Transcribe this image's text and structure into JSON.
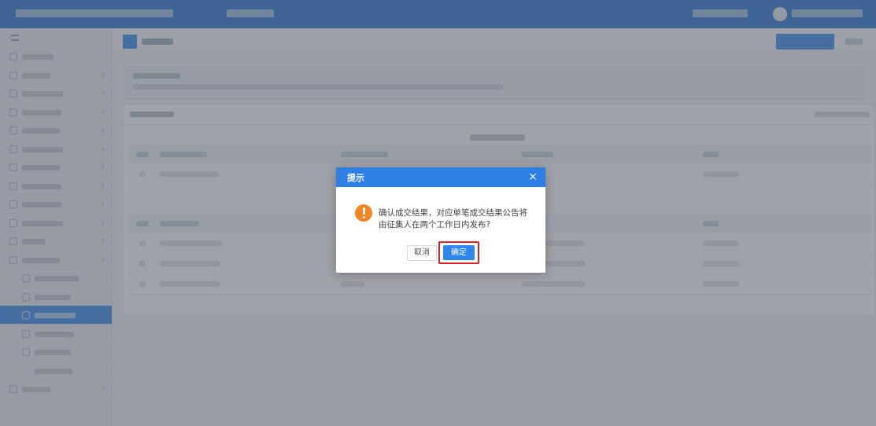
{
  "dialog": {
    "title": "提示",
    "close_glyph": "×",
    "message": "确认成交结果，对应单笔成交结果公告将由征集人在两个工作日内发布?",
    "cancel_label": "取消",
    "confirm_label": "确定"
  },
  "icons": {
    "dialog_icon": "warning-icon",
    "close": "close-icon",
    "sidebar_toggle": "menu-icon"
  },
  "colors": {
    "primary": "#2d7fe6",
    "warning": "#f4861f",
    "highlight_border": "#e02020",
    "active_sidebar": "#3c8dee"
  }
}
